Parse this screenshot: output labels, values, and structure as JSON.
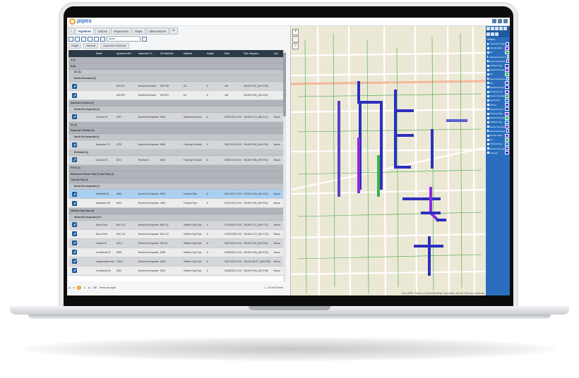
{
  "app": {
    "name": "pipes"
  },
  "tabs": [
    {
      "label": "Pipelines",
      "active": true
    },
    {
      "label": "Actions"
    },
    {
      "label": "Inspections"
    },
    {
      "label": "Maps"
    },
    {
      "label": "Observations"
    }
  ],
  "toolbar": {
    "view_value": "None"
  },
  "chips": [
    "Height",
    "Material",
    "Inspection Schedule"
  ],
  "columns": [
    "Street",
    "Upstream MH",
    "Inspection R...",
    "DS Manhole",
    "Material",
    "Height",
    "Date",
    "Pipe Segmen...",
    "City"
  ],
  "rows": [
    {
      "kind": "grp",
      "text": "0 (1)"
    },
    {
      "kind": "grp",
      "text": "8 (8)"
    },
    {
      "kind": "grp2",
      "text": "AC (1)"
    },
    {
      "kind": "grp2",
      "text": "Needs Reviewed (2)"
    },
    {
      "kind": "data",
      "cells": [
        "",
        "MH-P47",
        "Needs Reviewed",
        "MH-P48",
        "AC",
        "8",
        "null",
        "GM-MH-P47_(MH-P48)",
        ""
      ]
    },
    {
      "kind": "data",
      "alt": true,
      "cells": [
        "",
        "MH-P50",
        "Needs Reviewed",
        "MH-P51",
        "AC",
        "8",
        "null",
        "GM-MH-P50_(MH-P51)",
        ""
      ]
    },
    {
      "kind": "grp",
      "text": "Asbestos Cement (1)"
    },
    {
      "kind": "grp2",
      "text": "Needs Re-Inspected (1)"
    },
    {
      "kind": "data",
      "cells": [
        "Concord St",
        "0207",
        "Needs Re-Inspected",
        "8206",
        "Asbestos Cement",
        "8",
        "03/09/2021 3:00 PM",
        "GM-MH-C12_(MH-C11)",
        "Ithaca"
      ]
    },
    {
      "kind": "grp",
      "text": "GL (1)"
    },
    {
      "kind": "grp",
      "text": "Polyvinyl Chloride (2)"
    },
    {
      "kind": "grp2",
      "text": "Needs Re-Inspected (1)"
    },
    {
      "kind": "data",
      "cells": [
        "Haymaker Trl",
        "4793",
        "Needs Re-Inspected",
        "8806",
        "Polyvinyl Chloride",
        "8",
        "03/07/2021 5:00 PM",
        "GM-MH-P60_(MH-P59)",
        "Ithaca"
      ]
    },
    {
      "kind": "grp2",
      "text": "Reviewed (1)"
    },
    {
      "kind": "data",
      "cells": [
        "Concord St",
        "8072",
        "Reviewed",
        "8202",
        "Polyvinyl Chloride",
        "8",
        "03/08/2021 5:00 PM",
        "GM-MH-P58_(MH-P61)",
        "Ithaca"
      ]
    },
    {
      "kind": "grp",
      "text": "PVCO (1)"
    },
    {
      "kind": "grp",
      "text": "Reinforced Plastic Pipe (Truss Pipe) (1)"
    },
    {
      "kind": "grp",
      "text": "Transite Pipe (1)"
    },
    {
      "kind": "grp2",
      "text": "Needs Re-Inspected (1)"
    },
    {
      "kind": "data",
      "sel": true,
      "cells": [
        "Smithfield St",
        "8803",
        "Needs Re-Inspected",
        "8804",
        "Transite Pipe",
        "8",
        "03/11/2021 3:00 PM",
        "GM-MH-D23_(MH-D22)",
        "Ithaca"
      ]
    },
    {
      "kind": "data",
      "alt": true,
      "cells": [
        "Haymaker Rd",
        "8004",
        "Needs Re-Inspected",
        "4992",
        "Transite Pipe",
        "8",
        "03/12/2021 3:00 PM",
        "GM-MH-P62_(MH-P61)",
        "Ithaca"
      ]
    },
    {
      "kind": "grp",
      "text": "Vitrified Clay Pipe (4)"
    },
    {
      "kind": "grp2",
      "text": "Needs Re-Inspected (27)"
    },
    {
      "kind": "data",
      "cells": [
        "Dean Drive",
        "MH-C12",
        "Needs Re-Inspected",
        "MH-C11",
        "Vitrified Clay Pipe",
        "8",
        "07/18/2020 3:00 PM",
        "GM-MH-C11_(MH-C12)",
        "Ithaca"
      ]
    },
    {
      "kind": "data",
      "alt": true,
      "cells": [
        "Dean Drive",
        "MH-C13",
        "Needs Re-Inspected",
        "MH-C12",
        "Vitrified Clay Pipe",
        "8",
        "07/02/2008 3:00 PM",
        "GM-MH-C12_(MH-C13)",
        "Ithaca"
      ]
    },
    {
      "kind": "data",
      "cells": [
        "Holland St",
        "MH-4",
        "Needs Re-Inspected",
        "MH-4A",
        "Vitrified Clay Pipe",
        "8",
        "08/27/2021 3:00 PM",
        "GM-MH-P62_(MH-P61)",
        "Ithaca"
      ]
    },
    {
      "kind": "data",
      "alt": true,
      "cells": [
        "Continental St",
        "8228",
        "Needs Re-Inspected",
        "8238",
        "Vitrified Clay Pipe",
        "8",
        "03/08/2021 3:00 PM",
        "GM-MH-P45_(MH-P44)",
        "Ithaca"
      ]
    },
    {
      "kind": "data",
      "cells": [
        "Longmeadow Ave",
        "10014",
        "Needs Re-Inspected",
        "8168",
        "Vitrified Clay Pipe",
        "8",
        "03/07/2021 3:00 PM",
        "GM-MH-MCP7_(MH-P68)",
        "Ithaca"
      ]
    },
    {
      "kind": "data",
      "alt": true,
      "cells": [
        "Continental St",
        "8022",
        "Needs Re-Inspected",
        "8222",
        "Vitrified Clay Pipe",
        "8",
        "03/08/2021 3:00 PM",
        "GM-MH-P43_(MH-P46)",
        "Ithaca"
      ]
    }
  ],
  "pager": {
    "current": "1",
    "per_page": "250",
    "per_page_label": "items per page",
    "range": "1 - 50 of 50 items"
  },
  "map": {
    "streets": [
      "Ridge Rd",
      "Sassafrass Ave",
      "Sperry Rd",
      "Sassafrass Ave",
      "Dolan St",
      "Maple St",
      "Tennis Ave",
      "Beech Ave",
      "Sperry Ave",
      "Iroquois Dr"
    ],
    "attribution": "Esri, HERE, Garmin, (c) OpenStreetMap contributors, and the GIS user community"
  },
  "layers": {
    "search_label": "Search",
    "items": [
      "Inspection Data",
      "Gravity Main",
      "P1",
      "Asbestos Cement",
      "Needs Reviewed",
      "Vitrified Clay",
      "Needs Re-insp",
      "P2",
      "Needs Reviewed",
      "P3",
      "Needs Re-insp",
      "Polyvinyl Chl",
      "Needs Re-insp",
      "Reviewed",
      "PVCO",
      "Reinforced Pl",
      "Transite Pipe",
      "Needs Re-insp",
      "Vitrified Clay",
      "Needs Re-insp",
      "Needs Reviewed",
      "Needs Taken",
      "P4",
      "Vitrified Clay",
      "Needs Re-insp",
      "Laterals"
    ],
    "colors": [
      "#2a2fc0",
      "#8a2be2",
      "#3bb54a",
      "#1f7ad8",
      "#5b3fc8"
    ]
  },
  "colors": {
    "accent": "#2a6ebd",
    "pipe": "#2b2fbf",
    "logo": "#f39a1e"
  }
}
